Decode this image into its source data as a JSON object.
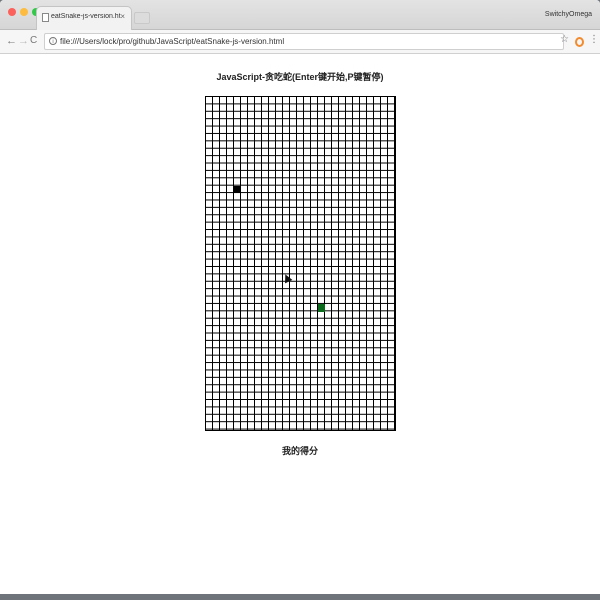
{
  "browser": {
    "tab_title": "eatSnake-js-version.html",
    "tab_close": "×",
    "profile_name": "SwitchyOmega",
    "url": "file:///Users/lock/pro/github/JavaScript/eatSnake-js-version.html",
    "nav": {
      "back": "←",
      "forward": "→",
      "reload": "C"
    },
    "icons": {
      "bookmark": "☆",
      "menu": "⋮",
      "info": "i"
    }
  },
  "game": {
    "title": "JavaScript-贪吃蛇(Enter键开始,P键暂停)",
    "score_label": "我的得分",
    "board": {
      "columns": 27,
      "rows": 45
    },
    "snake": [
      [
        4,
        12
      ]
    ],
    "food": [
      16,
      28
    ],
    "colors": {
      "snake": "#000000",
      "food": "#0a6b1c",
      "grid": "#000000"
    }
  }
}
